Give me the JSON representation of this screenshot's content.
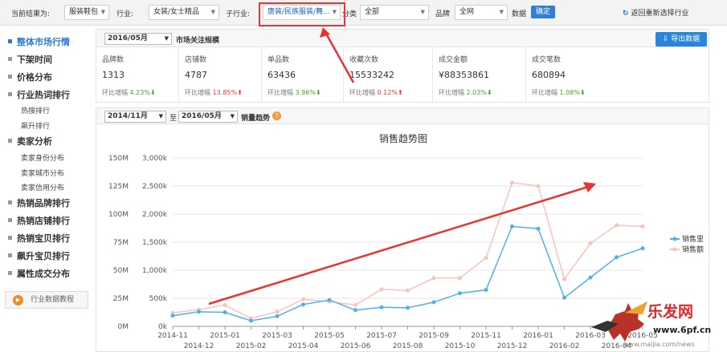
{
  "topbar": {
    "current_result_label": "当前结果为:",
    "category": "服装鞋包",
    "industry_label": "行业:",
    "industry": "女装/女士精品",
    "subindustry_label": "子行业:",
    "subindustry": "唐装/民族服装/舞...",
    "class_label": "分类",
    "class": "全部",
    "brand_label": "品牌",
    "brand": "全网",
    "data_label": "数据",
    "confirm": "确定",
    "reselect": "返回重新选择行业"
  },
  "sidebar": {
    "items": [
      {
        "label": "整体市场行情",
        "active": true
      },
      {
        "label": "下架时间"
      },
      {
        "label": "价格分布"
      },
      {
        "label": "行业热词排行"
      },
      {
        "label": "热搜排行",
        "sub": true
      },
      {
        "label": "飙升排行",
        "sub": true
      },
      {
        "label": "卖家分析"
      },
      {
        "label": "卖家身份分布",
        "sub": true
      },
      {
        "label": "卖家城市分布",
        "sub": true
      },
      {
        "label": "卖家信用分布",
        "sub": true
      },
      {
        "label": "热销品牌排行"
      },
      {
        "label": "热销店铺排行"
      },
      {
        "label": "热销宝贝排行"
      },
      {
        "label": "飙升宝贝排行"
      },
      {
        "label": "属性成交分布"
      }
    ],
    "tutorial": "行业数据教程"
  },
  "metrics": {
    "month": "2016/05月",
    "title": "市场关注规模",
    "export": "导出数据",
    "cards": [
      {
        "label": "品牌数",
        "value": "1313",
        "change_label": "环比增幅",
        "change": "4.23%",
        "dir": "down"
      },
      {
        "label": "店铺数",
        "value": "4787",
        "change_label": "环比增幅",
        "change": "13.85%",
        "dir": "up"
      },
      {
        "label": "单品数",
        "value": "63436",
        "change_label": "环比增幅",
        "change": "3.96%",
        "dir": "down"
      },
      {
        "label": "收藏次数",
        "value": "15533242",
        "change_label": "环比增幅",
        "change": "0.12%",
        "dir": "up"
      },
      {
        "label": "成交金额",
        "value": "¥88353861",
        "change_label": "环比增幅",
        "change": "2.03%",
        "dir": "down"
      },
      {
        "label": "成交笔数",
        "value": "680894",
        "change_label": "环比增幅",
        "change": "1.08%",
        "dir": "down"
      }
    ]
  },
  "trend": {
    "from": "2014/11月",
    "to_label": "至",
    "to": "2016/05月",
    "title": "销量趋势"
  },
  "colors": {
    "volume": "#4db3e6",
    "amount": "#f6c4bc",
    "arrow": "#e53535",
    "accent": "#2a7ad2"
  },
  "chart_data": {
    "type": "line",
    "title": "销售趋势图",
    "x": [
      "2014-11",
      "2014-12",
      "2015-01",
      "2015-02",
      "2015-03",
      "2015-04",
      "2015-05",
      "2015-06",
      "2015-07",
      "2015-08",
      "2015-09",
      "2015-10",
      "2015-11",
      "2015-12",
      "2016-01",
      "2016-02",
      "2016-03",
      "2016-04",
      "2016-05"
    ],
    "x_ticks_upper": [
      "2014-11",
      "2015-01",
      "2015-03",
      "2015-05",
      "2015-07",
      "2015-09",
      "2015-11",
      "2016-01",
      "2016-03",
      "2016-05"
    ],
    "x_ticks_lower": [
      "2014-12",
      "2015-02",
      "2015-04",
      "2015-06",
      "2015-08",
      "2015-10",
      "2015-12",
      "2016-02",
      "2016-04"
    ],
    "y_left_ticks": [
      "0M",
      "25M",
      "50M",
      "75M",
      "100M",
      "125M",
      "150M"
    ],
    "y_right_ticks": [
      "0k",
      "500k",
      "1,000k",
      "1,500k",
      "2,000k",
      "2,500k",
      "3,000k"
    ],
    "y_left_range": [
      0,
      150
    ],
    "y_right_range": [
      0,
      3000
    ],
    "series": [
      {
        "name": "销售里",
        "axis": "right",
        "values": [
          190,
          260,
          250,
          100,
          180,
          390,
          470,
          290,
          340,
          330,
          430,
          590,
          650,
          1780,
          1740,
          510,
          870,
          1230,
          1390
        ]
      },
      {
        "name": "销售额",
        "axis": "left",
        "values": [
          12,
          15,
          19,
          7,
          13,
          24,
          22,
          19,
          33,
          32,
          43,
          43,
          61,
          128,
          125,
          42,
          74,
          90,
          89
        ]
      }
    ],
    "legend_position": "right"
  },
  "watermark": {
    "brand": "乐发网",
    "url": "www.6pf.cn",
    "small": "www.maijia.com/news"
  }
}
